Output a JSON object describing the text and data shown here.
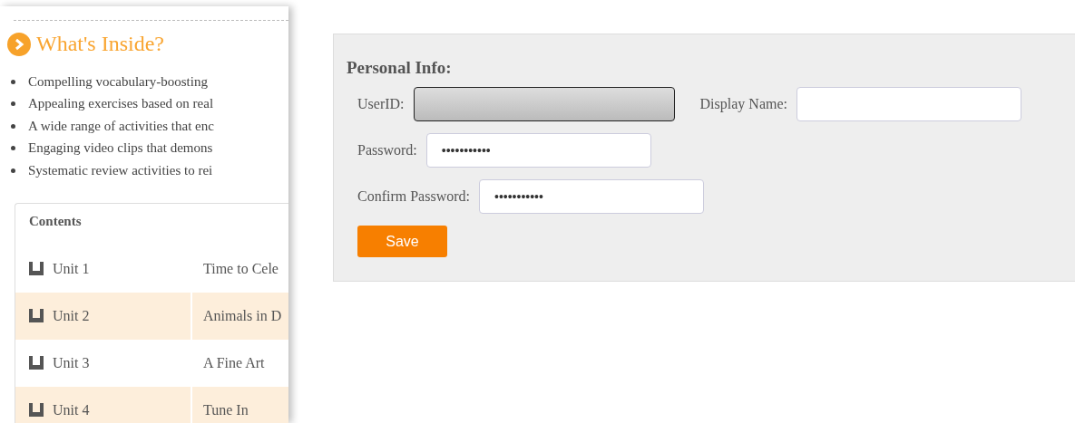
{
  "sidebar": {
    "title": "What's Inside?",
    "bullets": [
      "Compelling vocabulary-boosting",
      "Appealing exercises based on real",
      "A wide range of activities that enc",
      "Engaging video clips that demons",
      "Systematic review activities to rei"
    ],
    "contents": {
      "heading": "Contents",
      "rows": [
        {
          "unit": "Unit 1",
          "title": "Time to Cele"
        },
        {
          "unit": "Unit 2",
          "title": "Animals in D"
        },
        {
          "unit": "Unit 3",
          "title": "A Fine Art"
        },
        {
          "unit": "Unit 4",
          "title": "Tune In"
        }
      ]
    }
  },
  "form": {
    "title": "Personal Info:",
    "fields": [
      {
        "label": "UserID:",
        "disabled": true
      },
      {
        "label": "Display Name:",
        "disabled": false
      },
      {
        "label": "Password:",
        "value": "•••••••••••",
        "disabled": false
      },
      {
        "label": "Confirm Password:",
        "value": "•••••••••••",
        "disabled": false
      }
    ],
    "button": "Save"
  }
}
